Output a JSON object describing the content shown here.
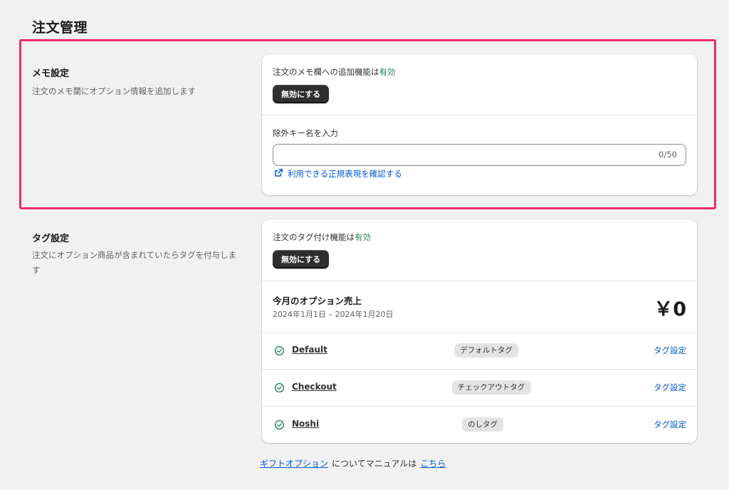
{
  "page": {
    "title": "注文管理"
  },
  "colors": {
    "highlight_border": "#ec2c6d",
    "status_on": "#29845a",
    "link": "#005bd3",
    "button_bg": "#2f2f2f"
  },
  "memo": {
    "title": "メモ設定",
    "description": "注文のメモ蘭にオプション情報を追加します",
    "status_prefix": "注文のメモ欄への追加機能は",
    "status_value": "有効",
    "disable_button": "無効にする",
    "exclude_label": "除外キー名を入力",
    "exclude_value": "",
    "exclude_counter": "0/50",
    "regex_link": "利用できる正規表現を確認する",
    "regex_link_icon": "external-link-icon"
  },
  "tags": {
    "title": "タグ設定",
    "description": "注文にオプション商品が含まれていたらタグを付与します",
    "status_prefix": "注文のタグ付け機能は",
    "status_value": "有効",
    "disable_button": "無効にする",
    "sales": {
      "title": "今月のオプション売上",
      "range": "2024年1月1日 – 2024年1月20日",
      "amount": "￥0"
    },
    "rows": [
      {
        "name": "Default",
        "badge": "デフォルトタグ",
        "action": "タグ設定",
        "icon": "check-circle-icon"
      },
      {
        "name": "Checkout",
        "badge": "チェックアウトタグ",
        "action": "タグ設定",
        "icon": "check-circle-icon"
      },
      {
        "name": "Noshi",
        "badge": "のしタグ",
        "action": "タグ設定",
        "icon": "check-circle-icon"
      }
    ]
  },
  "footer": {
    "link1": "ギフトオプション",
    "middle": "についてマニュアルは",
    "link2": "こちら"
  }
}
